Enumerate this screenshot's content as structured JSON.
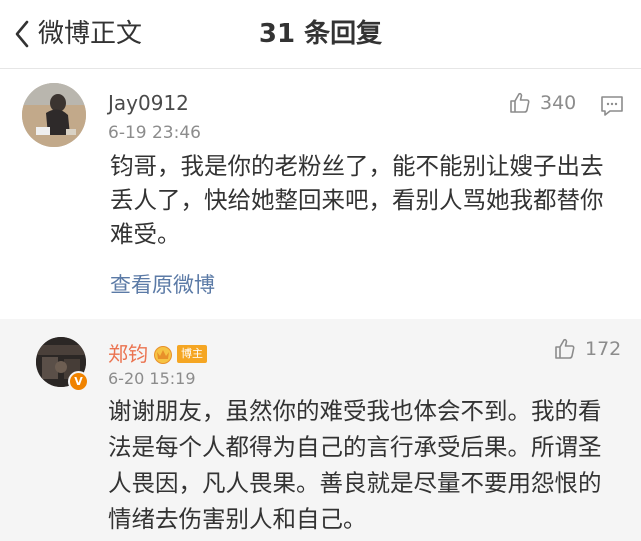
{
  "header": {
    "back_label": "微博正文",
    "title": "31 条回复"
  },
  "comment": {
    "username": "Jay0912",
    "time": "6-19 23:46",
    "likes": "340",
    "body": "钧哥，我是你的老粉丝了，能不能别让嫂子出去丢人了，快给她整回来吧，看别人骂她我都替你难受。",
    "view_original": "查看原微博"
  },
  "reply": {
    "username": "郑钧",
    "badge": "博主",
    "vip_mark": "V",
    "time": "6-20 15:19",
    "likes": "172",
    "body": "谢谢朋友，虽然你的难受我也体会不到。我的看法是每个人都得为自己的言行承受后果。所谓圣人畏因，凡人畏果。善良就是尽量不要用怨恨的情绪去伤害别人和自己。"
  },
  "colors": {
    "accent_username": "#eb7350",
    "link": "#5b7aa6",
    "badge": "#f5a623",
    "vip": "#f08300",
    "reply_bg": "#f5f5f5"
  },
  "icons": {
    "back": "chevron-left-icon",
    "like": "thumbs-up-icon",
    "reply": "comment-icon",
    "crown": "crown-icon"
  }
}
